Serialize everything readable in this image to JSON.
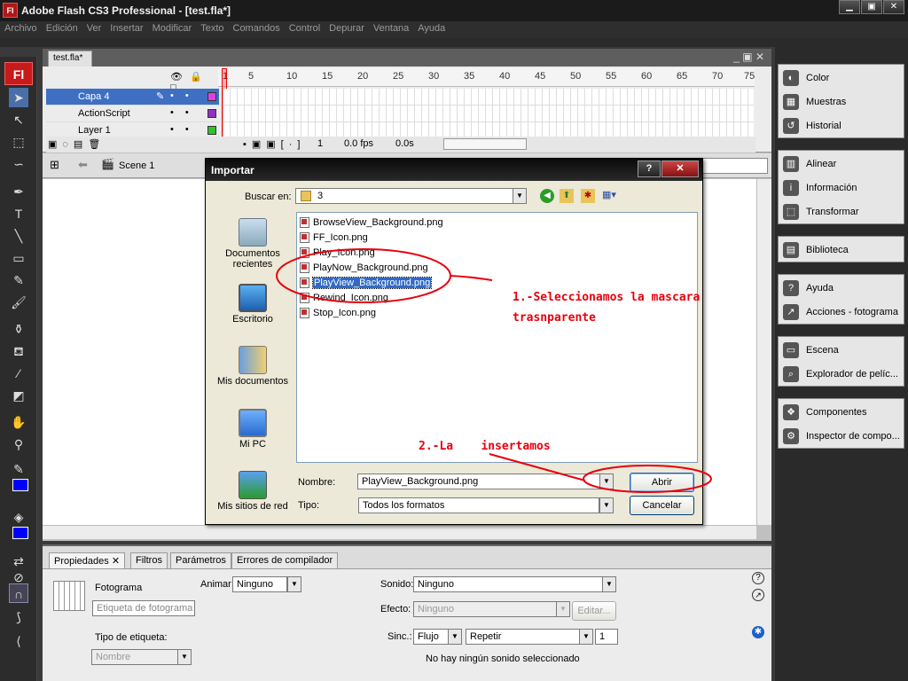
{
  "window": {
    "title": "Adobe Flash CS3 Professional - [test.fla*]",
    "logo": "Fl"
  },
  "menu": [
    "Archivo",
    "Edición",
    "Ver",
    "Insertar",
    "Modificar",
    "Texto",
    "Comandos",
    "Control",
    "Depurar",
    "Ventana",
    "Ayuda"
  ],
  "document": {
    "tab": "test.fla*"
  },
  "timeline": {
    "frame_numbers": [
      "1",
      "5",
      "10",
      "15",
      "20",
      "25",
      "30",
      "35",
      "40",
      "45",
      "50",
      "55",
      "60",
      "65",
      "70",
      "75"
    ],
    "layers": [
      {
        "name": "Capa 4",
        "color": "#e040e0",
        "selected": true
      },
      {
        "name": "ActionScript",
        "color": "#9030c0",
        "selected": false
      },
      {
        "name": "Layer 1",
        "color": "#30c030",
        "selected": false
      }
    ],
    "footer": {
      "frame": "1",
      "fps": "0.0 fps",
      "time": "0.0s"
    }
  },
  "scene": {
    "label": "Scene 1"
  },
  "panels": {
    "group1": [
      "Color",
      "Muestras",
      "Historial"
    ],
    "group2": [
      "Alinear",
      "Información",
      "Transformar"
    ],
    "group3": [
      "Biblioteca"
    ],
    "group4": [
      "Ayuda",
      "Acciones - fotograma"
    ],
    "group5": [
      "Escena",
      "Explorador de pelíc..."
    ],
    "group6": [
      "Componentes",
      "Inspector de compo..."
    ]
  },
  "properties": {
    "tabs": [
      "Propiedades",
      "Filtros",
      "Parámetros",
      "Errores de compilador"
    ],
    "frame_label": "Fotograma",
    "frame_name_placeholder": "Etiqueta de fotograma",
    "label_type_label": "Tipo de etiqueta:",
    "label_type_value": "Nombre",
    "tween_label": "Animar:",
    "tween_value": "Ninguno",
    "sound_label": "Sonido:",
    "sound_value": "Ninguno",
    "effect_label": "Efecto:",
    "effect_value": "Ninguno",
    "edit_button": "Editar...",
    "sync_label": "Sinc.:",
    "sync_value": "Flujo",
    "repeat_value": "Repetir",
    "repeat_count": "1",
    "no_sound": "No hay ningún sonido seleccionado"
  },
  "dialog": {
    "title": "Importar",
    "help_btn": "?",
    "close_btn": "✕",
    "lookin_label": "Buscar en:",
    "lookin_value": "3",
    "places": [
      "Documentos recientes",
      "Escritorio",
      "Mis documentos",
      "Mi PC",
      "Mis sitios de red"
    ],
    "files": [
      {
        "name": "BrowseView_Background.png",
        "selected": false
      },
      {
        "name": "FF_Icon.png",
        "selected": false
      },
      {
        "name": "Play_Icon.png",
        "selected": false
      },
      {
        "name": "PlayNow_Background.png",
        "selected": false
      },
      {
        "name": "PlayView_Background.png",
        "selected": true
      },
      {
        "name": "Rewind_Icon.png",
        "selected": false
      },
      {
        "name": "Stop_Icon.png",
        "selected": false
      }
    ],
    "name_label": "Nombre:",
    "name_value": "PlayView_Background.png",
    "type_label": "Tipo:",
    "type_value": "Todos los formatos",
    "open_btn": "Abrir",
    "cancel_btn": "Cancelar"
  },
  "annotations": {
    "note1_line1": "1.-Seleccionamos la mascara",
    "note1_line2": "trasnparente",
    "note2": "2.-La    insertamos",
    "color": "#e8000e"
  }
}
